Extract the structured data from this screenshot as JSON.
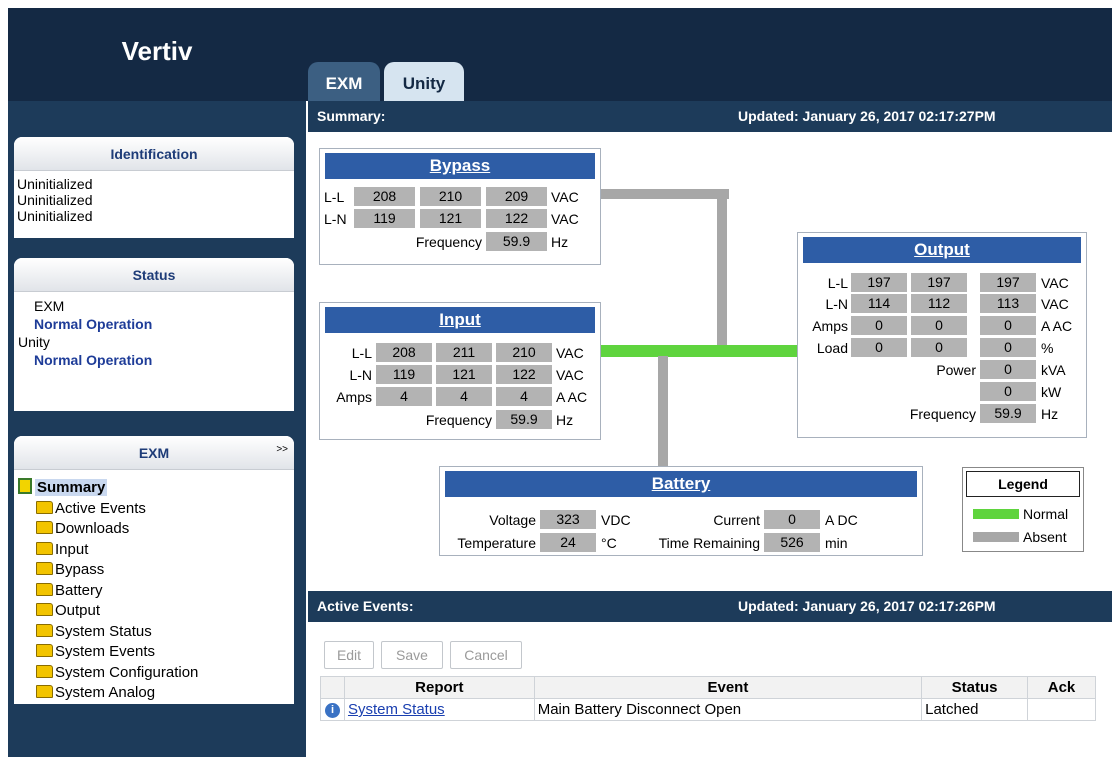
{
  "app": {
    "brand": "Vertiv"
  },
  "tabs": [
    {
      "label": "EXM"
    },
    {
      "label": "Unity"
    }
  ],
  "sidebar": {
    "identification": {
      "title": "Identification",
      "lines": [
        "Uninitialized",
        "Uninitialized",
        "Uninitialized"
      ]
    },
    "status": {
      "title": "Status",
      "units": [
        {
          "name": "EXM",
          "state": "Normal Operation"
        },
        {
          "name": "Unity",
          "state": "Normal Operation"
        }
      ]
    },
    "exm": {
      "title": "EXM",
      "expand": ">>",
      "tree_root": "Summary",
      "tree_items": [
        "Active Events",
        "Downloads",
        "Input",
        "Bypass",
        "Battery",
        "Output",
        "System Status",
        "System Events",
        "System Configuration",
        "System Analog"
      ]
    }
  },
  "summary": {
    "label": "Summary:",
    "updated": "Updated: January 26, 2017 02:17:27PM",
    "bypass": {
      "title": "Bypass",
      "ll_label": "L-L",
      "ll": [
        "208",
        "210",
        "209"
      ],
      "ll_unit": "VAC",
      "ln_label": "L-N",
      "ln": [
        "119",
        "121",
        "122"
      ],
      "ln_unit": "VAC",
      "freq_label": "Frequency",
      "freq": "59.9",
      "freq_unit": "Hz"
    },
    "input": {
      "title": "Input",
      "ll_label": "L-L",
      "ll": [
        "208",
        "211",
        "210"
      ],
      "ll_unit": "VAC",
      "ln_label": "L-N",
      "ln": [
        "119",
        "121",
        "122"
      ],
      "ln_unit": "VAC",
      "amps_label": "Amps",
      "amps": [
        "4",
        "4",
        "4"
      ],
      "amps_unit": "A AC",
      "freq_label": "Frequency",
      "freq": "59.9",
      "freq_unit": "Hz"
    },
    "output": {
      "title": "Output",
      "ll_label": "L-L",
      "ll": [
        "197",
        "197",
        "197"
      ],
      "ll_unit": "VAC",
      "ln_label": "L-N",
      "ln": [
        "114",
        "112",
        "113"
      ],
      "ln_unit": "VAC",
      "amps_label": "Amps",
      "amps": [
        "0",
        "0",
        "0"
      ],
      "amps_unit": "A AC",
      "load_label": "Load",
      "load": [
        "0",
        "0",
        "0"
      ],
      "load_unit": "%",
      "power_label": "Power",
      "kva": "0",
      "kva_unit": "kVA",
      "kw": "0",
      "kw_unit": "kW",
      "freq_label": "Frequency",
      "freq": "59.9",
      "freq_unit": "Hz"
    },
    "battery": {
      "title": "Battery",
      "voltage_label": "Voltage",
      "voltage": "323",
      "voltage_unit": "VDC",
      "current_label": "Current",
      "current": "0",
      "current_unit": "A DC",
      "temp_label": "Temperature",
      "temp": "24",
      "temp_unit": "°C",
      "time_label": "Time Remaining",
      "time": "526",
      "time_unit": "min"
    },
    "legend": {
      "title": "Legend",
      "items": [
        {
          "label": "Normal",
          "color": "#5fd43e"
        },
        {
          "label": "Absent",
          "color": "#a7a7a7"
        }
      ]
    }
  },
  "events": {
    "label": "Active Events:",
    "updated": "Updated: January 26, 2017 02:17:26PM",
    "buttons": {
      "edit": "Edit",
      "save": "Save",
      "cancel": "Cancel"
    },
    "columns": {
      "report": "Report",
      "event": "Event",
      "status": "Status",
      "ack": "Ack"
    },
    "rows": [
      {
        "icon": "info-icon",
        "icon_glyph": "i",
        "report": "System Status",
        "event": "Main Battery Disconnect Open",
        "status": "Latched",
        "ack": ""
      }
    ]
  }
}
